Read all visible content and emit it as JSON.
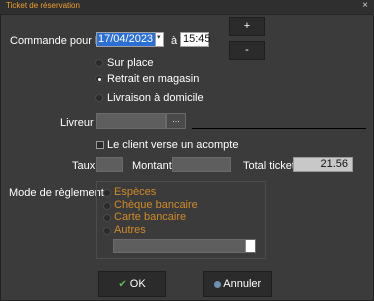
{
  "window": {
    "title": "Ticket de réservation",
    "close_glyph": "×"
  },
  "order": {
    "label": "Commande pour le",
    "date": "17/04/2023",
    "at_label": "à",
    "time": "15:45",
    "plus": "+",
    "minus": "-"
  },
  "options": {
    "sur_place": "Sur place",
    "retrait": "Retrait en magasin",
    "livraison": "Livraison à domicile",
    "selected": "retrait"
  },
  "livreur": {
    "label": "Livreur",
    "browse": "..."
  },
  "acompte": {
    "label": "Le client verse un acompte",
    "checked": false
  },
  "amounts": {
    "taux_label": "Taux",
    "montant_label": "Montant",
    "total_label": "Total ticket",
    "total_value": "21.56"
  },
  "payment": {
    "label": "Mode de règlement",
    "options": [
      "Espèces",
      "Chèque bancaire",
      "Carte bancaire",
      "Autres"
    ]
  },
  "buttons": {
    "ok": "OK",
    "cancel": "Annuler"
  },
  "icons": {
    "close": "close-icon",
    "dropdown": "chevron-down-icon",
    "ok": "checkmark-icon",
    "cancel": "cancel-icon"
  }
}
